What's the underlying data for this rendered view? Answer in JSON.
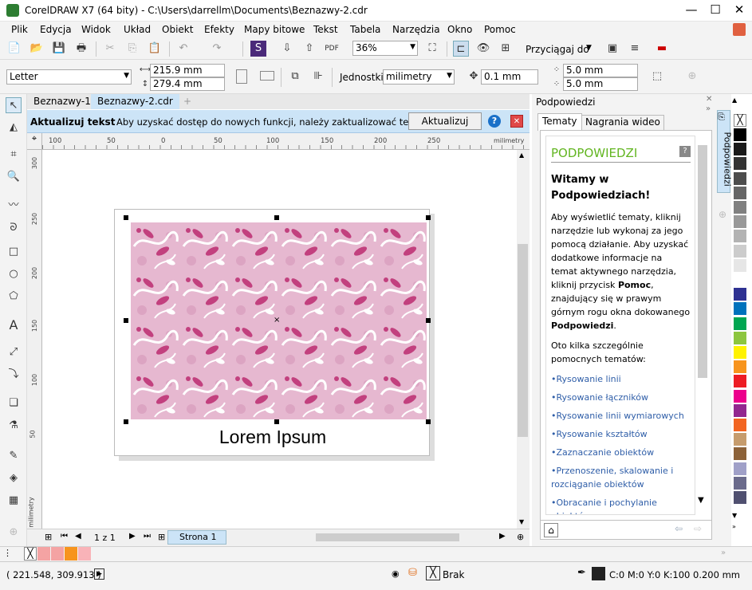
{
  "window": {
    "title": "CorelDRAW X7 (64 bity) - C:\\Users\\darrellm\\Documents\\Beznazwy-2.cdr"
  },
  "menu": [
    "Plik",
    "Edycja",
    "Widok",
    "Układ",
    "Obiekt",
    "Efekty",
    "Mapy bitowe",
    "Tekst",
    "Tabela",
    "Narzędzia",
    "Okno",
    "Pomoc"
  ],
  "toolbar": {
    "zoom": "36%",
    "snap_label": "Przyciągaj do"
  },
  "propbar": {
    "page_size": "Letter",
    "width": "215.9 mm",
    "height": "279.4 mm",
    "units_label": "Jednostki:",
    "units": "milimetry",
    "nudge": "0.1 mm",
    "dup_x": "5.0 mm",
    "dup_y": "5.0 mm"
  },
  "doc_tabs": [
    "Beznazwy-1",
    "Beznazwy-2.cdr"
  ],
  "infobar": {
    "title": "Aktualizuj tekst",
    "dash": "-",
    "message": "Aby uzyskać dostęp do nowych funkcji, należy zaktualizować tekst.",
    "button": "Aktualizuj"
  },
  "ruler": {
    "h_ticks": [
      "100",
      "50",
      "0",
      "50",
      "100",
      "150",
      "200",
      "250"
    ],
    "h_unit": "milimetry",
    "v_ticks": [
      "300",
      "250",
      "200",
      "150",
      "100",
      "50"
    ],
    "v_unit": "milimetry"
  },
  "canvas": {
    "caption": "Lorem Ipsum"
  },
  "pagebar": {
    "page_count": "1 z 1",
    "page_tab": "Strona 1"
  },
  "dock": {
    "title": "Podpowiedzi",
    "tabs": [
      "Tematy",
      "Nagrania wideo"
    ],
    "heading": "PODPOWIEDZI",
    "welcome": "Witamy w Podpowiedziach!",
    "intro_parts": [
      "Aby wyświetlić tematy, kliknij narzędzie lub wykonaj za jego pomocą działanie. Aby uzyskać dodatkowe informacje na temat aktywnego narzędzia, kliknij przycisk ",
      "Pomoc",
      ", znajdujący się w prawym górnym rogu okna dokowanego ",
      "Podpowiedzi",
      "."
    ],
    "topics_intro": "Oto kilka szczególnie pomocnych tematów:",
    "links": [
      "Rysowanie linii",
      "Rysowanie łączników",
      "Rysowanie linii wymiarowych",
      "Rysowanie kształtów",
      "Zaznaczanie obiektów",
      "Przenoszenie, skalowanie i rozciąganie obiektów",
      "Obracanie i pochylanie obiektów"
    ],
    "side_tab": "Podpowiedzi"
  },
  "palette_colors": [
    "#000000",
    "#1a1a1a",
    "#333333",
    "#4d4d4d",
    "#666666",
    "#808080",
    "#999999",
    "#b3b3b3",
    "#cccccc",
    "#e6e6e6",
    "#ffffff",
    "#2e3192",
    "#0072bc",
    "#00a651",
    "#8dc63f",
    "#fff200",
    "#f7941d",
    "#ed1c24",
    "#ec008c",
    "#92278f",
    "#f26522",
    "#c69c6d",
    "#8c6239",
    "#a0a0c8",
    "#6b6b8c",
    "#505070"
  ],
  "doc_palette_colors": [
    "#f4a3a3",
    "#f4a3a3",
    "#f7941d",
    "#f9b3b8"
  ],
  "status": {
    "coords": "( 221.548, 309.913 )",
    "fill_label": "Brak",
    "outline": "C:0 M:0 Y:0 K:100  0.200 mm"
  }
}
